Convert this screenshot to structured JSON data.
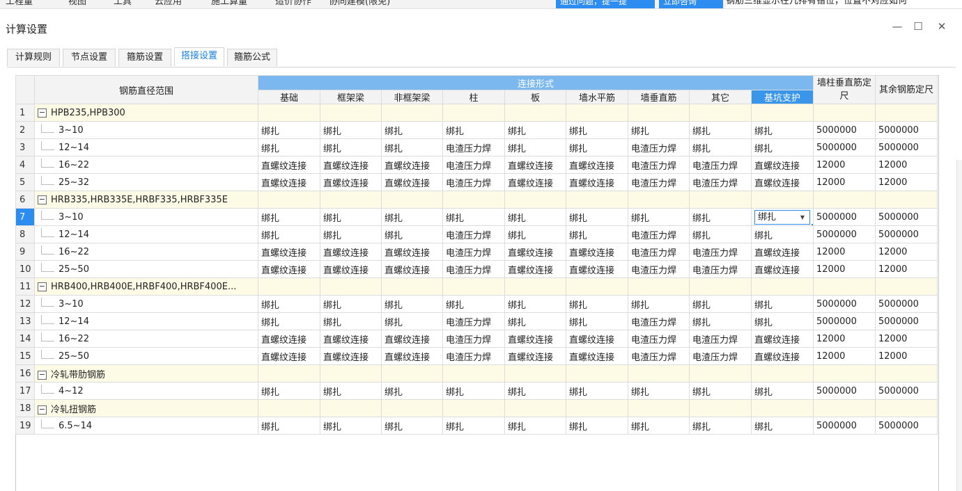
{
  "menubar": {
    "items": [
      "工程量",
      "视图",
      "工具",
      "云应用",
      "施工算量",
      "造价协作",
      "协同建模(限免)"
    ],
    "blue_buttons": [
      "通过问题，提一提",
      "立即咨询"
    ],
    "tip": "钢筋三维显示在几排有错位，位置不对应如何"
  },
  "dialog": {
    "title": "计算设置",
    "minimize_icon": "—",
    "maximize_icon": "☐",
    "close_icon": "✕"
  },
  "tabs": [
    {
      "label": "计算规则",
      "active": false
    },
    {
      "label": "节点设置",
      "active": false
    },
    {
      "label": "箍筋设置",
      "active": false
    },
    {
      "label": "搭接设置",
      "active": true
    },
    {
      "label": "箍筋公式",
      "active": false
    }
  ],
  "table": {
    "header": {
      "range_label": "钢筋直径范围",
      "group_label": "连接形式",
      "columns": [
        "基础",
        "框架梁",
        "非框架梁",
        "柱",
        "板",
        "墙水平筋",
        "墙垂直筋",
        "其它",
        "基坑支护"
      ],
      "wall_col_label": "墙柱垂直筋定尺",
      "other_col_label": "其余钢筋定尺"
    },
    "rows": [
      {
        "n": "1",
        "group": true,
        "label": "HPB235,HPB300"
      },
      {
        "n": "2",
        "label": "3~10",
        "cells": [
          "绑扎",
          "绑扎",
          "绑扎",
          "绑扎",
          "绑扎",
          "绑扎",
          "绑扎",
          "绑扎",
          "绑扎",
          "5000000",
          "5000000"
        ]
      },
      {
        "n": "3",
        "label": "12~14",
        "cells": [
          "绑扎",
          "绑扎",
          "绑扎",
          "电渣压力焊",
          "绑扎",
          "绑扎",
          "电渣压力焊",
          "绑扎",
          "绑扎",
          "5000000",
          "5000000"
        ]
      },
      {
        "n": "4",
        "label": "16~22",
        "cells": [
          "直螺纹连接",
          "直螺纹连接",
          "直螺纹连接",
          "电渣压力焊",
          "直螺纹连接",
          "直螺纹连接",
          "电渣压力焊",
          "电渣压力焊",
          "直螺纹连接",
          "12000",
          "12000"
        ]
      },
      {
        "n": "5",
        "label": "25~32",
        "cells": [
          "直螺纹连接",
          "直螺纹连接",
          "直螺纹连接",
          "电渣压力焊",
          "直螺纹连接",
          "直螺纹连接",
          "电渣压力焊",
          "电渣压力焊",
          "直螺纹连接",
          "12000",
          "12000"
        ]
      },
      {
        "n": "6",
        "group": true,
        "label": "HRB335,HRB335E,HRBF335,HRBF335E"
      },
      {
        "n": "7",
        "label": "3~10",
        "selected": true,
        "cells": [
          "绑扎",
          "绑扎",
          "绑扎",
          "绑扎",
          "绑扎",
          "绑扎",
          "绑扎",
          "绑扎",
          "绑扎",
          "5000000",
          "5000000"
        ]
      },
      {
        "n": "8",
        "label": "12~14",
        "cells": [
          "绑扎",
          "绑扎",
          "绑扎",
          "电渣压力焊",
          "绑扎",
          "绑扎",
          "电渣压力焊",
          "绑扎",
          "绑扎",
          "5000000",
          "5000000"
        ]
      },
      {
        "n": "9",
        "label": "16~22",
        "cells": [
          "直螺纹连接",
          "直螺纹连接",
          "直螺纹连接",
          "电渣压力焊",
          "直螺纹连接",
          "直螺纹连接",
          "电渣压力焊",
          "电渣压力焊",
          "直螺纹连接",
          "12000",
          "12000"
        ]
      },
      {
        "n": "10",
        "label": "25~50",
        "cells": [
          "直螺纹连接",
          "直螺纹连接",
          "直螺纹连接",
          "电渣压力焊",
          "直螺纹连接",
          "直螺纹连接",
          "电渣压力焊",
          "电渣压力焊",
          "直螺纹连接",
          "12000",
          "12000"
        ]
      },
      {
        "n": "11",
        "group": true,
        "label": "HRB400,HRB400E,HRBF400,HRBF400E..."
      },
      {
        "n": "12",
        "label": "3~10",
        "cells": [
          "绑扎",
          "绑扎",
          "绑扎",
          "绑扎",
          "绑扎",
          "绑扎",
          "绑扎",
          "绑扎",
          "绑扎",
          "5000000",
          "5000000"
        ]
      },
      {
        "n": "13",
        "label": "12~14",
        "cells": [
          "绑扎",
          "绑扎",
          "绑扎",
          "电渣压力焊",
          "绑扎",
          "绑扎",
          "电渣压力焊",
          "绑扎",
          "绑扎",
          "5000000",
          "5000000"
        ]
      },
      {
        "n": "14",
        "label": "16~22",
        "cells": [
          "直螺纹连接",
          "直螺纹连接",
          "直螺纹连接",
          "电渣压力焊",
          "直螺纹连接",
          "直螺纹连接",
          "电渣压力焊",
          "电渣压力焊",
          "直螺纹连接",
          "12000",
          "12000"
        ]
      },
      {
        "n": "15",
        "label": "25~50",
        "cells": [
          "直螺纹连接",
          "直螺纹连接",
          "直螺纹连接",
          "电渣压力焊",
          "直螺纹连接",
          "直螺纹连接",
          "电渣压力焊",
          "电渣压力焊",
          "直螺纹连接",
          "12000",
          "12000"
        ]
      },
      {
        "n": "16",
        "group": true,
        "label": "冷轧带肋钢筋"
      },
      {
        "n": "17",
        "label": "4~12",
        "cells": [
          "绑扎",
          "绑扎",
          "绑扎",
          "绑扎",
          "绑扎",
          "绑扎",
          "绑扎",
          "绑扎",
          "绑扎",
          "5000000",
          "5000000"
        ]
      },
      {
        "n": "18",
        "group": true,
        "label": "冷轧扭钢筋"
      },
      {
        "n": "19",
        "label": "6.5~14",
        "cells": [
          "绑扎",
          "绑扎",
          "绑扎",
          "绑扎",
          "绑扎",
          "绑扎",
          "绑扎",
          "绑扎",
          "绑扎",
          "5000000",
          "5000000"
        ]
      }
    ]
  },
  "colors": {
    "accent": "#2d8cf0",
    "group_row": "#fdfbe6",
    "header_blue": "#7ab8ef"
  }
}
